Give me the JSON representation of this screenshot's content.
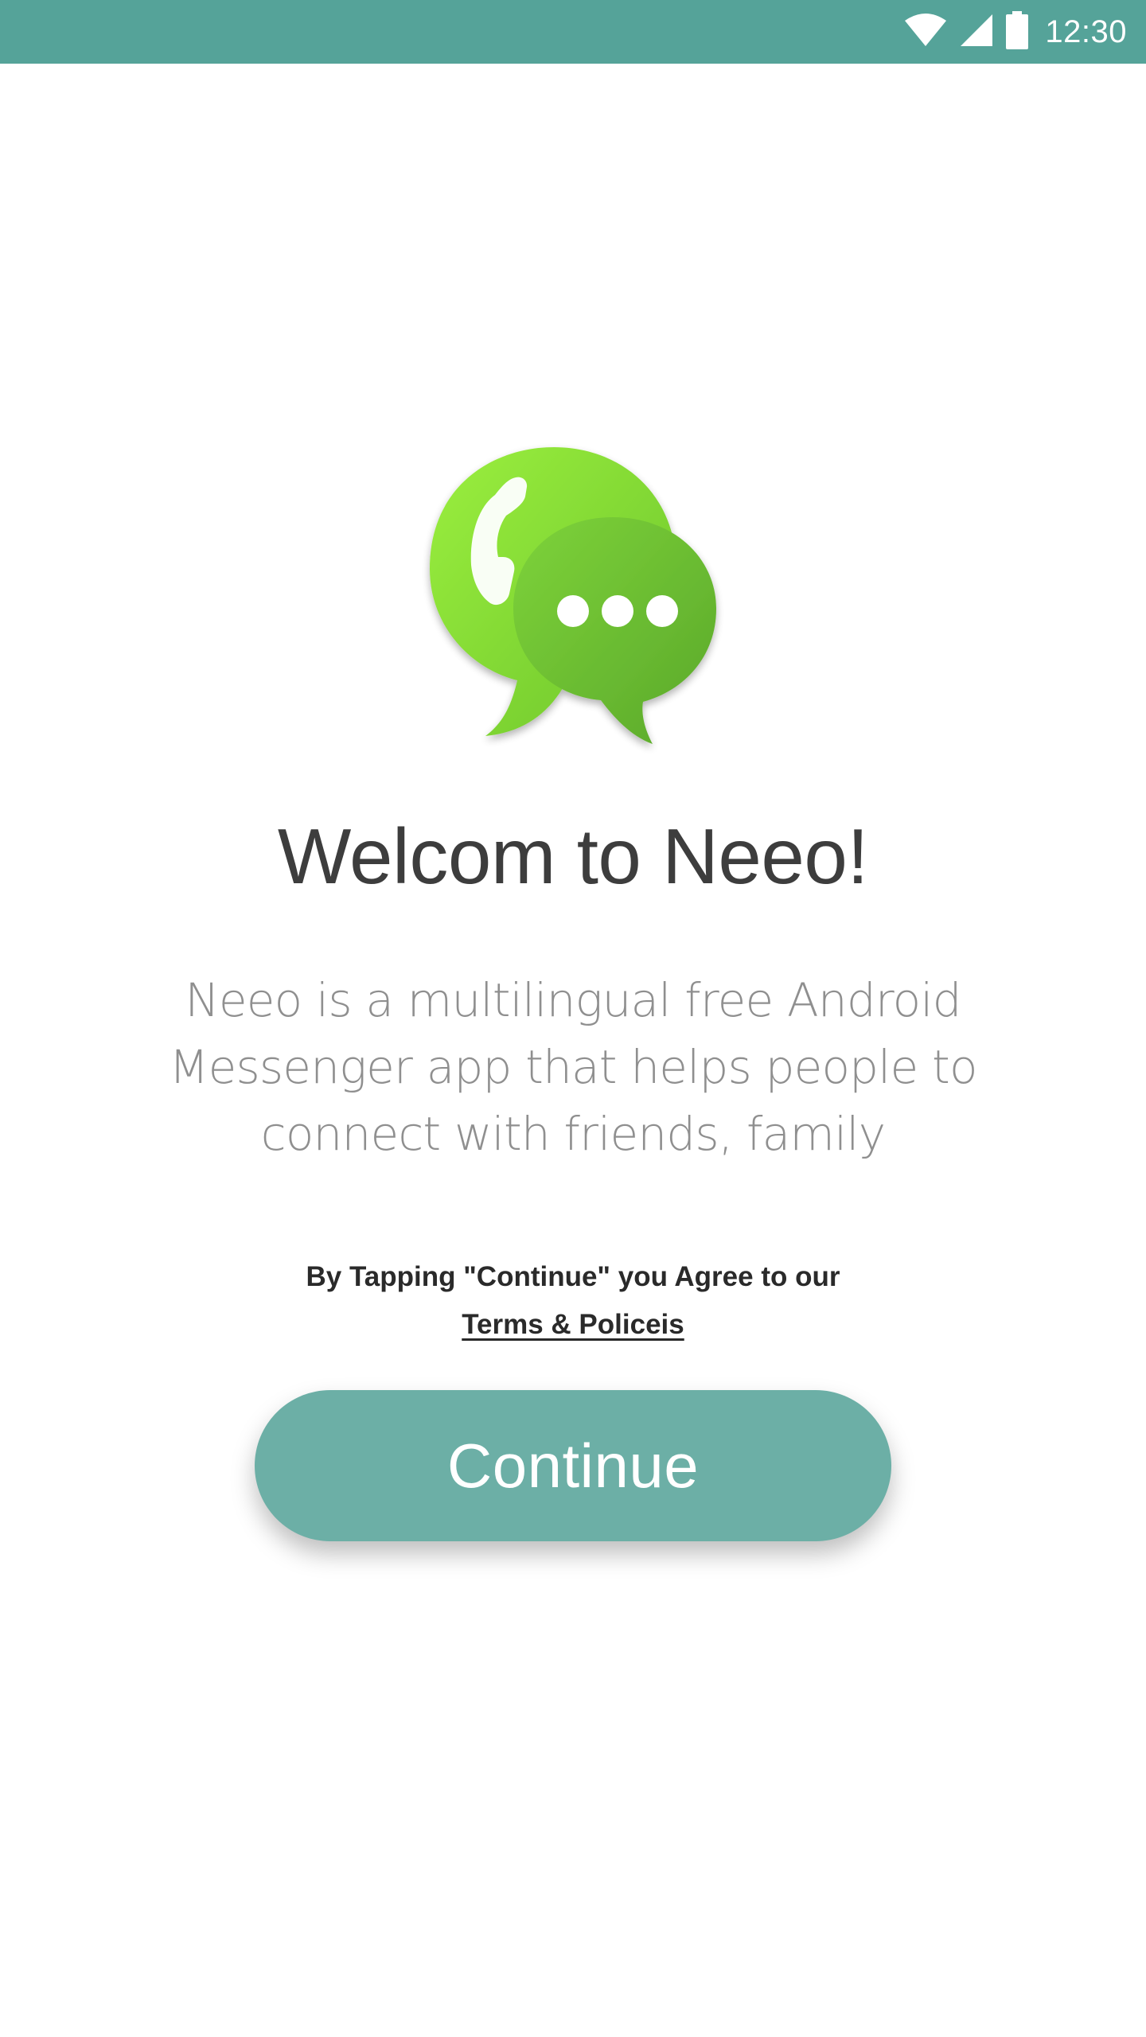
{
  "status_bar": {
    "time": "12:30",
    "color": "#55a399",
    "icons": [
      "wifi-icon",
      "signal-icon",
      "battery-icon"
    ]
  },
  "logo": {
    "icon": "chat-bubbles-logo-icon",
    "colors": [
      "#8ee63a",
      "#66b52c"
    ]
  },
  "welcome": {
    "title": "Welcom to Neeo!",
    "description": "Neeo is a multilingual free Android Messenger app that helps people to connect with friends, family"
  },
  "agreement": {
    "text": "By Tapping \"Continue\" you Agree to our",
    "link_label": "Terms & Policeis"
  },
  "continue_button": {
    "label": "Continue",
    "color": "#6cafa6"
  }
}
